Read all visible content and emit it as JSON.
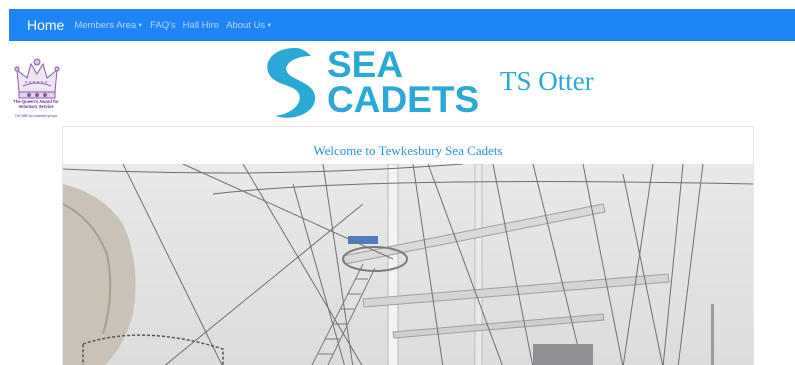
{
  "navbar": {
    "brand": "Home",
    "items": [
      {
        "label": "Members Area",
        "dropdown": true
      },
      {
        "label": "FAQ's",
        "dropdown": false
      },
      {
        "label": "Hall Hire",
        "dropdown": false
      },
      {
        "label": "About Us",
        "dropdown": true
      }
    ],
    "background": "#1d84f5"
  },
  "header": {
    "award": {
      "title": "The Queen's Award for Voluntary Service",
      "tagline": "The MBE for volunteer groups",
      "icon": "crown-icon"
    },
    "logo": {
      "word1": "SEA",
      "word2": "CADETS",
      "icon": "sea-cadets-wave-icon",
      "color": "#2aa8d6"
    },
    "unit_name": "TS Otter"
  },
  "main": {
    "heading": "Welcome to Tewkesbury Sea Cadets",
    "photo_icon": "tall-ship-rigging-photo"
  }
}
